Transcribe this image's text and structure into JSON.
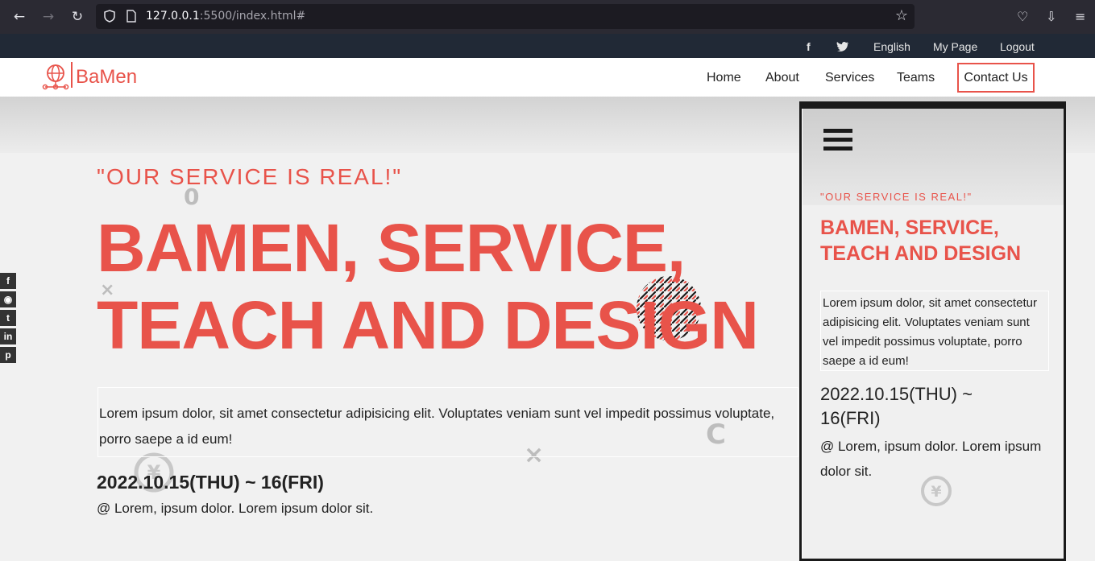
{
  "browser": {
    "url_host": "127.0.0.1",
    "url_path": ":5500/index.html#",
    "back_icon": "arrow-left-icon",
    "forward_icon": "arrow-right-icon",
    "reload_icon": "reload-icon"
  },
  "topbar": {
    "language": "English",
    "my_page": "My Page",
    "logout": "Logout"
  },
  "header": {
    "logo_text": "BaMen",
    "nav": [
      "Home",
      "About",
      "Services",
      "Teams",
      "Contact Us"
    ]
  },
  "hero": {
    "tagline": "\"OUR SERVICE IS REAL!\"",
    "title_line1": "BAMEN, SERVICE,",
    "title_line2": "TEACH AND DESIGN",
    "description": "Lorem ipsum dolor, sit amet consectetur adipisicing elit. Voluptates veniam sunt vel impedit possimus voluptate, porro saepe a id eum!",
    "date": "2022.10.15(THU) ~ 16(FRI)",
    "place": "@ Lorem, ipsum dolor. Lorem ipsum dolor sit."
  },
  "mobile": {
    "tagline": "\"OUR SERVICE IS REAL!\"",
    "title_line1": "BAMEN, SERVICE,",
    "title_line2": "TEACH AND DESIGN",
    "description": "Lorem ipsum dolor, sit amet consectetur adipisicing elit. Voluptates veniam sunt vel impedit possimus voluptate, porro saepe a id eum!",
    "date": "2022.10.15(THU) ~ 16(FRI)",
    "place": "@ Lorem, ipsum dolor. Lorem ipsum dolor sit."
  },
  "colors": {
    "accent": "#e8534a",
    "topbar": "#212936"
  }
}
